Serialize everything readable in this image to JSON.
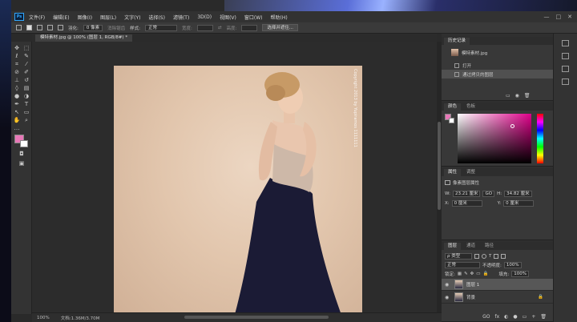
{
  "app": {
    "logo": "Ps"
  },
  "menu": [
    "文件(F)",
    "编辑(E)",
    "图像(I)",
    "图层(L)",
    "文字(Y)",
    "选择(S)",
    "滤镜(T)",
    "3D(D)",
    "视图(V)",
    "窗口(W)",
    "帮助(H)"
  ],
  "window_controls": [
    "—",
    "□",
    "✕"
  ],
  "options": {
    "feather_label": "羽化:",
    "feather_value": "0 像素",
    "antialias_label": "消除锯齿",
    "style_label": "样式:",
    "style_value": "正常",
    "width_label": "宽度:",
    "height_label": "高度:",
    "select_mask_button": "选择并遮住..."
  },
  "document": {
    "tab_label": "模特素材.jpg @ 100% (图层 1, RGB/8#) *",
    "watermark": "Copyright 2013 by Yupiramos 1111111"
  },
  "status": {
    "zoom": "100%",
    "doc_size": "文档:1.36M/3.70M"
  },
  "history": {
    "tabs": [
      "历史记录"
    ],
    "snapshot_name": "模特素材.jpg",
    "items": [
      "打开",
      "通过拷贝的图层"
    ]
  },
  "color": {
    "tabs": [
      "颜色",
      "色板"
    ],
    "foreground": "#e878b8",
    "background": "#ffffff"
  },
  "properties": {
    "tabs": [
      "属性",
      "调整"
    ],
    "title": "像素图层属性",
    "w_label": "W:",
    "w_value": "23.21 厘米",
    "link_label": "GO",
    "h_label": "H:",
    "h_value": "34.82 厘米",
    "x_label": "X:",
    "x_value": "0 厘米",
    "y_label": "Y:",
    "y_value": "0 厘米"
  },
  "layers": {
    "tabs": [
      "图层",
      "通道",
      "路径"
    ],
    "filter_label": "ρ 类型",
    "blend_mode": "正常",
    "opacity_label": "不透明度:",
    "opacity_value": "100%",
    "lock_label": "锁定:",
    "fill_label": "填充:",
    "fill_value": "100%",
    "items": [
      {
        "name": "图层 1",
        "selected": true
      },
      {
        "name": "背景",
        "selected": false
      }
    ],
    "footer_icons": [
      "GO",
      "fx",
      "◐",
      "●",
      "▭",
      "+",
      "🗑"
    ]
  }
}
